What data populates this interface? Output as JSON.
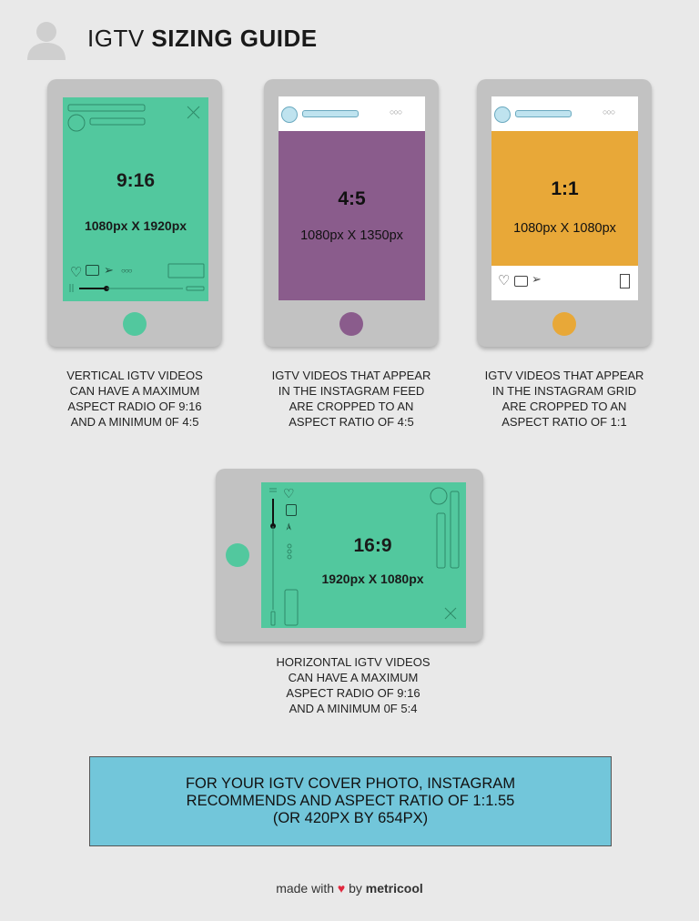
{
  "header": {
    "avatar_icon": "user-silhouette-icon",
    "title_light": "IGTV",
    "title_bold": "SIZING GUIDE"
  },
  "colors": {
    "background": "#e9e9e9",
    "phone_body": "#c2c2c2",
    "green": "#52c89e",
    "purple": "#8a5c8c",
    "orange": "#e8a838",
    "cover_box": "#72c6da",
    "heart": "#e0283e"
  },
  "phones": [
    {
      "id": "vertical",
      "ratio": "9:16",
      "dimensions": "1080px X 1920px",
      "caption": [
        "VERTICAL IGTV VIDEOS",
        "CAN HAVE A MAXIMUM",
        "ASPECT RADIO OF 9:16",
        "AND A MINIMUM 0F 4:5"
      ],
      "icons": [
        "heart-icon",
        "comment-icon",
        "send-icon",
        "more-dots-icon",
        "close-icon",
        "pause-icon",
        "progress-bar"
      ]
    },
    {
      "id": "feed",
      "ratio": "4:5",
      "dimensions": "1080px X 1350px",
      "caption": [
        "IGTV VIDEOS THAT APPEAR",
        "IN THE INSTAGRAM FEED",
        "ARE CROPPED TO AN",
        "ASPECT RATIO OF 4:5"
      ],
      "icons": [
        "profile-icon",
        "more-dots-icon"
      ]
    },
    {
      "id": "grid",
      "ratio": "1:1",
      "dimensions": "1080px X 1080px",
      "caption": [
        "IGTV VIDEOS THAT APPEAR",
        "IN THE INSTAGRAM GRID",
        "ARE CROPPED TO AN",
        "ASPECT RATIO OF 1:1"
      ],
      "icons": [
        "profile-icon",
        "more-dots-icon",
        "heart-icon",
        "comment-icon",
        "send-icon",
        "bookmark-icon"
      ]
    },
    {
      "id": "horizontal",
      "ratio": "16:9",
      "dimensions": "1920px X 1080px",
      "caption": [
        "HORIZONTAL IGTV VIDEOS",
        "CAN HAVE A MAXIMUM",
        "ASPECT RADIO OF 9:16",
        "AND A MINIMUM 0F 5:4"
      ],
      "icons": [
        "heart-icon",
        "comment-icon",
        "send-icon",
        "more-dots-icon",
        "close-icon"
      ]
    }
  ],
  "cover_note": {
    "lines": [
      "FOR YOUR IGTV COVER PHOTO, INSTAGRAM",
      "RECOMMENDS AND ASPECT RATIO OF 1:1.55",
      "(OR 420PX BY 654PX)"
    ]
  },
  "footer": {
    "prefix": "made with",
    "heart": "♥",
    "by": "by",
    "brand": "metricool"
  }
}
